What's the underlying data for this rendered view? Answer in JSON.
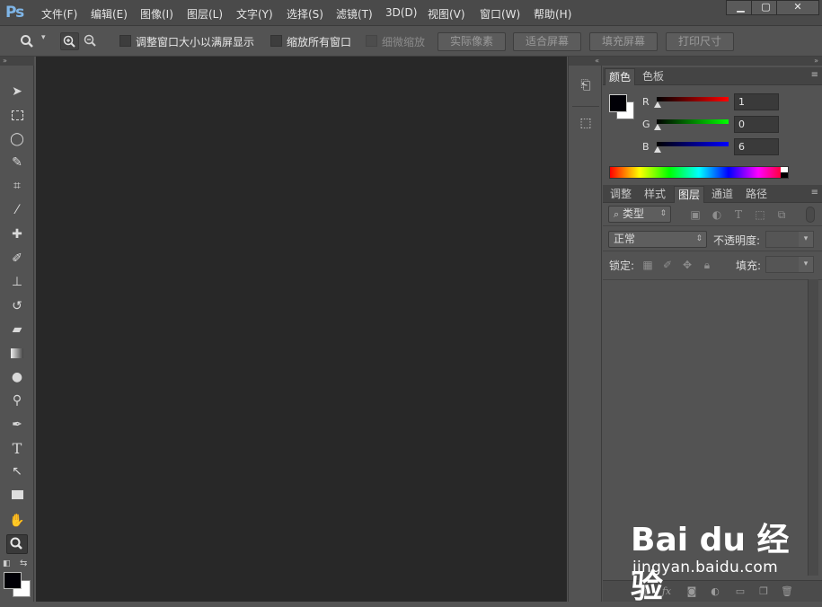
{
  "app": {
    "logo": "Ps"
  },
  "menu": [
    "文件(F)",
    "编辑(E)",
    "图像(I)",
    "图层(L)",
    "文字(Y)",
    "选择(S)",
    "滤镜(T)",
    "3D(D)",
    "视图(V)",
    "窗口(W)",
    "帮助(H)"
  ],
  "window_controls": {
    "minimize": "▁",
    "maximize": "▢",
    "close": "✕"
  },
  "options": {
    "resize_windows_label": "调整窗口大小以满屏显示",
    "zoom_all_label": "缩放所有窗口",
    "scrubby_zoom_label": "细微缩放",
    "actual_pixels": "实际像素",
    "fit_screen": "适合屏幕",
    "fill_screen": "填充屏幕",
    "print_size": "打印尺寸"
  },
  "color_panel": {
    "tabs": [
      "颜色",
      "色板"
    ],
    "r_label": "R",
    "g_label": "G",
    "b_label": "B",
    "r_value": "1",
    "g_value": "0",
    "b_value": "6",
    "foreground": "#010006",
    "background": "#ffffff"
  },
  "layers_panel": {
    "tabs": [
      "调整",
      "样式",
      "图层",
      "通道",
      "路径"
    ],
    "filter_label": "类型",
    "blend_mode": "正常",
    "opacity_label": "不透明度:",
    "lock_label": "锁定:",
    "fill_label": "填充:"
  },
  "watermark": {
    "logo": "Bai du 经验",
    "url": "jingyan.baidu.com"
  }
}
